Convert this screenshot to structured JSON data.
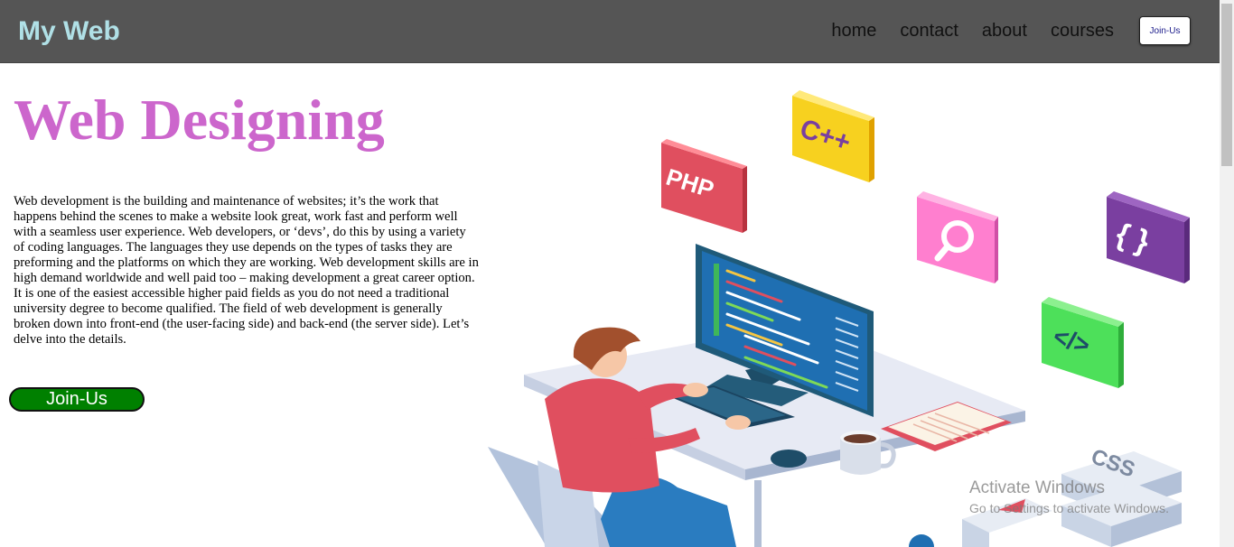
{
  "nav": {
    "brand": "My Web",
    "links": [
      "home",
      "contact",
      "about",
      "courses"
    ],
    "join_label": "Join-Us"
  },
  "hero": {
    "title": "Web Designing",
    "description": "Web development is the building and maintenance of websites; it’s the work that happens behind the scenes to make a website look great, work fast and perform well with a seamless user experience. Web developers, or ‘devs’, do this by using a variety of coding languages. The languages they use depends on the types of tasks they are preforming and the platforms on which they are working. Web development skills are in high demand worldwide and well paid too – making development a great career option. It is one of the easiest accessible higher paid fields as you do not need a traditional university degree to become qualified. The field of web development is generally broken down into front-end (the user-facing side) and back-end (the server side). Let’s delve into the details.",
    "join_label": "Join-Us"
  },
  "illustration": {
    "badges": [
      "PHP",
      "C++",
      "{ }",
      "</>",
      "CSS"
    ]
  },
  "watermark": {
    "title": "Activate Windows",
    "subtitle": "Go to Settings to activate Windows."
  }
}
